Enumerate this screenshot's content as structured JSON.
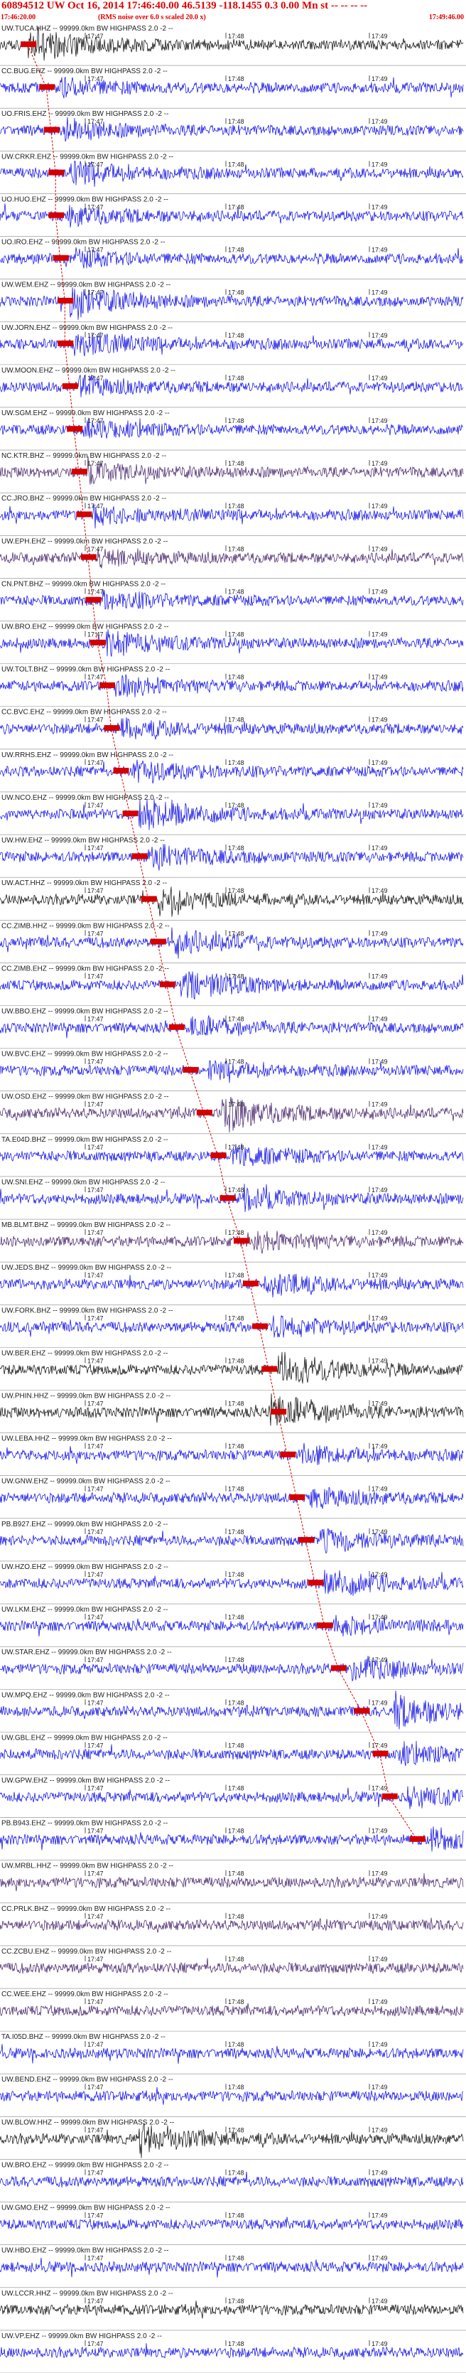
{
  "header": {
    "title": "60894512 UW Oct 16, 2014 17:46:40.00   46.5139 -118.1455  0.3 0.00 Mn st -- -- -- --",
    "start_time": "17:46:20.00",
    "rms_note": "(RMS noise over 6.0 s scaled 20.0 x)",
    "end_time": "17:49:46.00"
  },
  "chart_data": {
    "type": "seismogram",
    "ticks": [
      "17:47",
      "17:48",
      "17:49"
    ],
    "colors": {
      "blue": "#0000e6",
      "black": "#000000",
      "purple": "#3b1763",
      "pick": "#d40000",
      "guide": "#d40000"
    },
    "channels": [
      {
        "label": "UW.TUCA.HHZ -- 99999.0km BW HIGHPASS 2.0 -2 --",
        "color": "black",
        "pick": 0.06,
        "event": 0.06,
        "event_amp": 1.0
      },
      {
        "label": "CC.BUG.EHZ -- 99999.0km BW HIGHPASS 2.0 -2 --",
        "color": "blue",
        "pick": 0.1,
        "event": 0.13,
        "event_amp": 0.5
      },
      {
        "label": "UO.FRIS.EHZ -- 99999.0km BW HIGHPASS 2.0 -2 --",
        "color": "blue",
        "pick": 0.11,
        "event": 0.14,
        "event_amp": 0.5
      },
      {
        "label": "UW.CRKR.EHZ -- 99999.0km BW HIGHPASS 2.0 -2 --",
        "color": "blue",
        "pick": 0.12,
        "event": 0.15,
        "event_amp": 0.6
      },
      {
        "label": "UO.HUO.EHZ -- 99999.0km BW HIGHPASS 2.0 -2 --",
        "color": "blue",
        "pick": 0.12,
        "event": 0.15,
        "event_amp": 0.5
      },
      {
        "label": "UO.IRO.EHZ -- 99999.0km BW HIGHPASS 2.0 -2 --",
        "color": "blue",
        "pick": 0.13,
        "event": 0.16,
        "event_amp": 0.4
      },
      {
        "label": "UW.WEM.EHZ -- 99999.0km BW HIGHPASS 2.0 -2 --",
        "color": "blue",
        "pick": 0.14,
        "event": 0.15,
        "event_amp": 0.9
      },
      {
        "label": "UW.JORN.EHZ -- 99999.0km BW HIGHPASS 2.0 -2 --",
        "color": "blue",
        "pick": 0.14,
        "event": 0.16,
        "event_amp": 0.7
      },
      {
        "label": "UW.MOON.EHZ -- 99999.0km BW HIGHPASS 2.0 -2 --",
        "color": "blue",
        "pick": 0.15,
        "event": 0.17,
        "event_amp": 0.5
      },
      {
        "label": "UW.SGM.EHZ -- 99999.0km BW HIGHPASS 2.0 -2 --",
        "color": "blue",
        "pick": 0.16,
        "event": 0.18,
        "event_amp": 0.5
      },
      {
        "label": "NC.KTR.BHZ -- 99999.0km BW HIGHPASS 2.0 -2 --",
        "color": "purple",
        "pick": 0.17,
        "event": 0.19,
        "event_amp": 0.5
      },
      {
        "label": "CC.JRO.BHZ -- 99999.0km BW HIGHPASS 2.0 -2 --",
        "color": "blue",
        "pick": 0.18,
        "event": 0.2,
        "event_amp": 0.5
      },
      {
        "label": "UW.EPH.EHZ -- 99999.0km BW HIGHPASS 2.0 -2 --",
        "color": "purple",
        "pick": 0.19,
        "event": 0.21,
        "event_amp": 0.4
      },
      {
        "label": "CN.PNT.BHZ -- 99999.0km BW HIGHPASS 2.0 -2 --",
        "color": "blue",
        "pick": 0.2,
        "event": 0.22,
        "event_amp": 0.5
      },
      {
        "label": "UW.BRO.EHZ -- 99999.0km BW HIGHPASS 2.0 -2 --",
        "color": "blue",
        "pick": 0.21,
        "event": 0.23,
        "event_amp": 0.6
      },
      {
        "label": "UW.TOLT.BHZ -- 99999.0km BW HIGHPASS 2.0 -2 --",
        "color": "blue",
        "pick": 0.23,
        "event": 0.25,
        "event_amp": 0.5
      },
      {
        "label": "CC.BVC.EHZ -- 99999.0km BW HIGHPASS 2.0 -2 --",
        "color": "blue",
        "pick": 0.24,
        "event": 0.26,
        "event_amp": 0.5
      },
      {
        "label": "UW.RRHS.EHZ -- 99999.0km BW HIGHPASS 2.0 -2 --",
        "color": "blue",
        "pick": 0.26,
        "event": 0.28,
        "event_amp": 0.6
      },
      {
        "label": "UW.NCO.EHZ -- 99999.0km BW HIGHPASS 2.0 -2 --",
        "color": "blue",
        "pick": 0.28,
        "event": 0.3,
        "event_amp": 1.0
      },
      {
        "label": "UW.HW.EHZ -- 99999.0km BW HIGHPASS 2.0 -2 --",
        "color": "blue",
        "pick": 0.3,
        "event": 0.32,
        "event_amp": 0.7
      },
      {
        "label": "UW.ACT.HHZ -- 99999.0km BW HIGHPASS 2.0 -2 --",
        "color": "black",
        "pick": 0.32,
        "event": 0.34,
        "event_amp": 0.6
      },
      {
        "label": "CC.ZIMB.HHZ -- 99999.0km BW HIGHPASS 2.0 -2 --",
        "color": "blue",
        "pick": 0.34,
        "event": 0.37,
        "event_amp": 0.7
      },
      {
        "label": "CC.ZIMB.EHZ -- 99999.0km BW HIGHPASS 2.0 -2 --",
        "color": "blue",
        "pick": 0.36,
        "event": 0.39,
        "event_amp": 0.9
      },
      {
        "label": "UW.BBO.EHZ -- 99999.0km BW HIGHPASS 2.0 -2 --",
        "color": "blue",
        "pick": 0.38,
        "event": 0.41,
        "event_amp": 0.5
      },
      {
        "label": "UW.BVC.EHZ -- 99999.0km BW HIGHPASS 2.0 -2 --",
        "color": "blue",
        "pick": 0.41,
        "event": 0.45,
        "event_amp": 0.4
      },
      {
        "label": "UW.OSD.EHZ -- 99999.0km BW HIGHPASS 2.0 -2 --",
        "color": "purple",
        "pick": 0.44,
        "event": 0.48,
        "event_amp": 1.0
      },
      {
        "label": "TA.E04D.BHZ -- 99999.0km BW HIGHPASS 2.0 -2 --",
        "color": "blue",
        "pick": 0.47,
        "event": 0.5,
        "event_amp": 0.6
      },
      {
        "label": "UW.SNI.EHZ -- 99999.0km BW HIGHPASS 2.0 -2 --",
        "color": "blue",
        "pick": 0.49,
        "event": 0.52,
        "event_amp": 0.6
      },
      {
        "label": "MB.BLMT.BHZ -- 99999.0km BW HIGHPASS 2.0 -2 --",
        "color": "purple",
        "pick": 0.52,
        "event": 0.55,
        "event_amp": 0.5
      },
      {
        "label": "UW.JEDS.BHZ -- 99999.0km BW HIGHPASS 2.0 -2 --",
        "color": "blue",
        "pick": 0.54,
        "event": 0.57,
        "event_amp": 0.6
      },
      {
        "label": "UW.FORK.BHZ -- 99999.0km BW HIGHPASS 2.0 -2 --",
        "color": "blue",
        "pick": 0.56,
        "event": 0.59,
        "event_amp": 0.5
      },
      {
        "label": "UW.BER.EHZ -- 99999.0km BW HIGHPASS 2.0 -2 --",
        "color": "black",
        "pick": 0.58,
        "event": 0.6,
        "event_amp": 1.0
      },
      {
        "label": "UW.PHIN.HHZ -- 99999.0km BW HIGHPASS 2.0 -2 --",
        "color": "black",
        "pick": 0.6,
        "event": 0.58,
        "event_amp": 1.0
      },
      {
        "label": "UW.LEBA.HHZ -- 99999.0km BW HIGHPASS 2.0 -2 --",
        "color": "blue",
        "pick": 0.62,
        "event": 0.65,
        "event_amp": 0.5
      },
      {
        "label": "UW.GNW.EHZ -- 99999.0km BW HIGHPASS 2.0 -2 --",
        "color": "blue",
        "pick": 0.64,
        "event": 0.67,
        "event_amp": 0.5
      },
      {
        "label": "PB.B927.EHZ -- 99999.0km BW HIGHPASS 2.0 -2 --",
        "color": "blue",
        "pick": 0.66,
        "event": 0.69,
        "event_amp": 0.6
      },
      {
        "label": "UW.HZO.EHZ -- 99999.0km BW HIGHPASS 2.0 -2 --",
        "color": "blue",
        "pick": 0.68,
        "event": 0.7,
        "event_amp": 0.8
      },
      {
        "label": "UW.LKM.EHZ -- 99999.0km BW HIGHPASS 2.0 -2 --",
        "color": "blue",
        "pick": 0.7,
        "event": 0.72,
        "event_amp": 0.5
      },
      {
        "label": "UW.STAR.EHZ -- 99999.0km BW HIGHPASS 2.0 -2 --",
        "color": "blue",
        "pick": 0.73,
        "event": 0.76,
        "event_amp": 0.6
      },
      {
        "label": "UW.MPQ.EHZ -- 99999.0km BW HIGHPASS 2.0 -2 --",
        "color": "blue",
        "pick": 0.78,
        "event": 0.85,
        "event_amp": 1.0
      },
      {
        "label": "UW.GBL.EHZ -- 99999.0km BW HIGHPASS 2.0 -2 --",
        "color": "blue",
        "pick": 0.82,
        "event": 0.86,
        "event_amp": 0.5
      },
      {
        "label": "UW.GPW.EHZ -- 99999.0km BW HIGHPASS 2.0 -2 --",
        "color": "blue",
        "pick": 0.84,
        "event": 0.88,
        "event_amp": 0.5
      },
      {
        "label": "PB.B943.EHZ -- 99999.0km BW HIGHPASS 2.0 -2 --",
        "color": "blue",
        "pick": 0.9,
        "event": 0.93,
        "event_amp": 0.6
      },
      {
        "label": "UW.MRBL.HHZ -- 99999.0km BW HIGHPASS 2.0 -2 --",
        "color": "purple",
        "pick": null,
        "event": 0.0,
        "event_amp": 0.0
      },
      {
        "label": "CC.PRLK.BHZ -- 99999.0km BW HIGHPASS 2.0 -2 --",
        "color": "purple",
        "pick": null,
        "event": 0.0,
        "event_amp": 0.0
      },
      {
        "label": "CC.ZCBU.EHZ -- 99999.0km BW HIGHPASS 2.0 -2 --",
        "color": "purple",
        "pick": null,
        "event": 0.0,
        "event_amp": 0.0
      },
      {
        "label": "CC.WEE.EHZ -- 99999.0km BW HIGHPASS 2.0 -2 --",
        "color": "purple",
        "pick": null,
        "event": 0.0,
        "event_amp": 0.0
      },
      {
        "label": "TA.I05D.BHZ -- 99999.0km BW HIGHPASS 2.0 -2 --",
        "color": "blue",
        "pick": null,
        "event": 0.0,
        "event_amp": 0.0
      },
      {
        "label": "UW.BEND.EHZ -- 99999.0km BW HIGHPASS 2.0 -2 --",
        "color": "blue",
        "pick": null,
        "event": 0.0,
        "event_amp": 0.0
      },
      {
        "label": "UW.BLOW.HHZ -- 99999.0km BW HIGHPASS 2.0 -2 --",
        "color": "black",
        "pick": null,
        "event": 0.3,
        "event_amp": 0.8
      },
      {
        "label": "UW.BRO.EHZ -- 99999.0km BW HIGHPASS 2.0 -2 --",
        "color": "blue",
        "pick": null,
        "event": 0.0,
        "event_amp": 0.0
      },
      {
        "label": "UW.GMO.EHZ -- 99999.0km BW HIGHPASS 2.0 -2 --",
        "color": "blue",
        "pick": null,
        "event": 0.0,
        "event_amp": 0.0
      },
      {
        "label": "UW.HBO.EHZ -- 99999.0km BW HIGHPASS 2.0 -2 --",
        "color": "blue",
        "pick": null,
        "event": 0.0,
        "event_amp": 0.0
      },
      {
        "label": "UW.LCCR.HHZ -- 99999.0km BW HIGHPASS 2.0 -2 --",
        "color": "black",
        "pick": null,
        "event": 0.0,
        "event_amp": 0.0
      },
      {
        "label": "UW.VP.EHZ -- 99999.0km BW HIGHPASS 2.0 -2 --",
        "color": "blue",
        "pick": null,
        "event": 0.0,
        "event_amp": 0.0
      }
    ]
  }
}
